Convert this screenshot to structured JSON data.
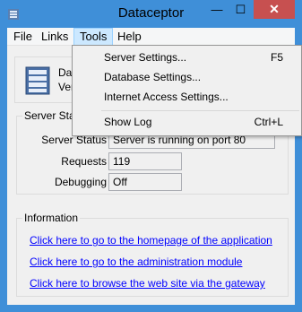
{
  "window": {
    "title": "Dataceptor",
    "controls": {
      "minimize": "—",
      "maximize": "☐",
      "close": "✕"
    }
  },
  "menubar": {
    "file": "File",
    "links": "Links",
    "tools": "Tools",
    "help": "Help"
  },
  "header": {
    "line1": "Dat",
    "line2": "Vers"
  },
  "status_group": {
    "title": "Server Statu",
    "server_status_label": "Server Status",
    "server_status_value": "Server is running on port 80",
    "requests_label": "Requests",
    "requests_value": "119",
    "debugging_label": "Debugging",
    "debugging_value": "Off"
  },
  "info_group": {
    "title": "Information",
    "link_homepage": "Click here to go to the homepage of the application",
    "link_admin": "Click here to go to the administration module",
    "link_gateway": "Click here to browse the web site via the gateway"
  },
  "tools_menu": {
    "items": [
      {
        "label": "Server Settings...",
        "shortcut": "F5"
      },
      {
        "label": "Database Settings...",
        "shortcut": ""
      },
      {
        "label": "Internet Access Settings...",
        "shortcut": ""
      },
      {
        "label": "Show Log",
        "shortcut": "Ctrl+L"
      }
    ]
  },
  "colors": {
    "frame": "#3f8fd8",
    "close_button": "#c75050",
    "link": "#0000ff",
    "menu_highlight": "#cce8ff"
  }
}
